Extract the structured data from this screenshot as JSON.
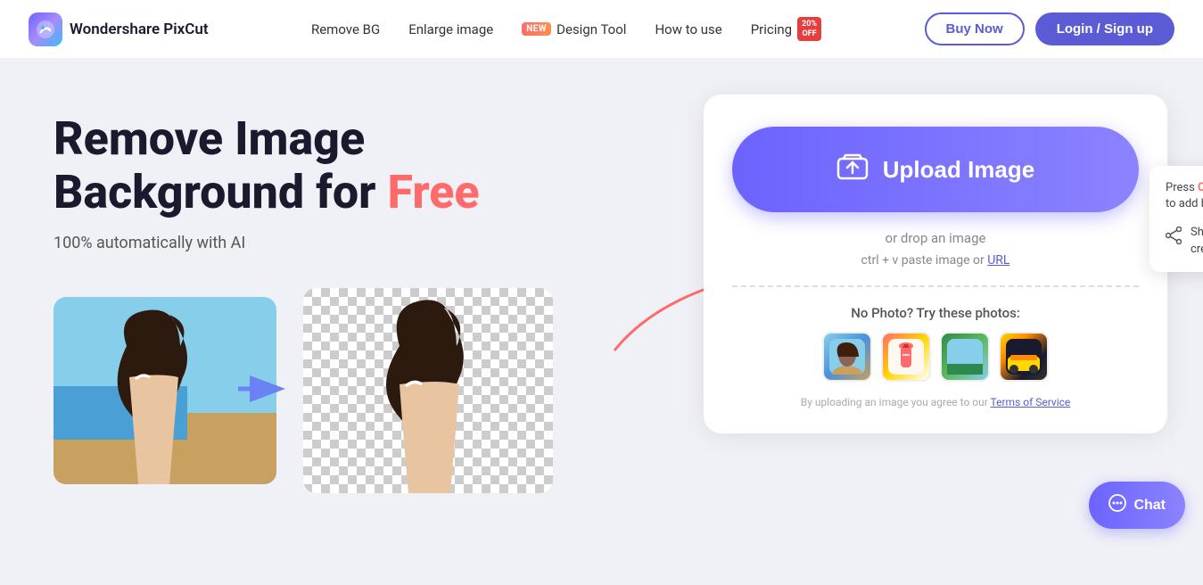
{
  "navbar": {
    "logo_text": "Wondershare PixCut",
    "links": [
      {
        "id": "remove-bg",
        "label": "Remove BG"
      },
      {
        "id": "enlarge-image",
        "label": "Enlarge image"
      },
      {
        "id": "design-tool",
        "label": "Design Tool",
        "badge": "NEW"
      },
      {
        "id": "how-to-use",
        "label": "How to use"
      },
      {
        "id": "pricing",
        "label": "Pricing",
        "badge": "20% OFF"
      }
    ],
    "buy_label": "Buy Now",
    "login_label": "Login / Sign up"
  },
  "hero": {
    "title_line1": "Remove Image",
    "title_line2": "Background for ",
    "title_free": "Free",
    "subtitle": "100% automatically with AI",
    "upload_btn_label": "Upload Image",
    "drop_text": "or drop an image",
    "paste_text": "ctrl + v paste image or URL",
    "sample_title": "No Photo? Try these photos:",
    "terms_text": "By uploading an image you agree to our ",
    "terms_link": "Terms of Service"
  },
  "bookmark_popup": {
    "ctrl_text": "Ctrl + D",
    "bookmark_text": "to add bookmark",
    "share_text": "Share to get credits"
  },
  "chat": {
    "label": "Chat"
  }
}
